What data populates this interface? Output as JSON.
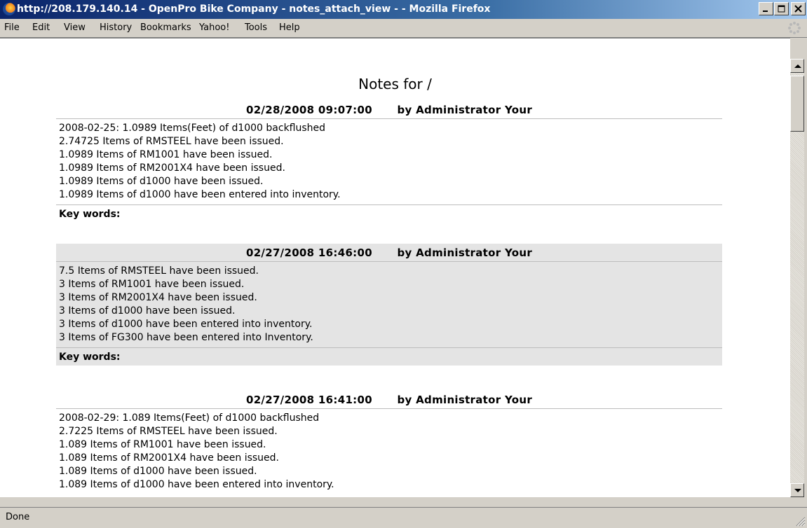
{
  "window": {
    "title": "http://208.179.140.14 - OpenPro Bike Company - notes_attach_view - - Mozilla Firefox"
  },
  "menu": {
    "items": [
      {
        "label": "File"
      },
      {
        "label": "Edit"
      },
      {
        "label": "View"
      },
      {
        "label": "History"
      },
      {
        "label": "Bookmarks"
      },
      {
        "label": "Yahoo!"
      },
      {
        "label": "Tools"
      },
      {
        "label": "Help"
      }
    ]
  },
  "page": {
    "title": "Notes for /",
    "notes": [
      {
        "datetime": "02/28/2008 09:07:00",
        "by": "by  Administrator Your",
        "lines": [
          "2008-02-25: 1.0989 Items(Feet) of d1000 backflushed",
          "2.74725 Items of RMSTEEL have been issued.",
          "1.0989 Items of RM1001 have been issued.",
          "1.0989 Items of RM2001X4 have been issued.",
          "1.0989 Items of d1000 have been issued.",
          "1.0989 Items of d1000 have been entered into inventory."
        ],
        "keywords_label": "Key words:"
      },
      {
        "datetime": "02/27/2008 16:46:00",
        "by": "by  Administrator Your",
        "lines": [
          "7.5 Items of RMSTEEL have been issued.",
          "3 Items of RM1001 have been issued.",
          "3 Items of RM2001X4 have been issued.",
          "3 Items of d1000 have been issued.",
          "3 Items of d1000 have been entered into inventory.",
          "3 Items of FG300 have been entered into Inventory."
        ],
        "keywords_label": "Key words:"
      },
      {
        "datetime": "02/27/2008 16:41:00",
        "by": "by  Administrator Your",
        "lines": [
          "2008-02-29: 1.089 Items(Feet) of d1000 backflushed",
          "2.7225 Items of RMSTEEL have been issued.",
          "1.089 Items of RM1001 have been issued.",
          "1.089 Items of RM2001X4 have been issued.",
          "1.089 Items of d1000 have been issued.",
          "1.089 Items of d1000 have been entered into inventory."
        ]
      }
    ]
  },
  "status": {
    "text": "Done"
  },
  "colors": {
    "shaded_row": "#e4e4e4",
    "titlebar": "#0a246a"
  }
}
